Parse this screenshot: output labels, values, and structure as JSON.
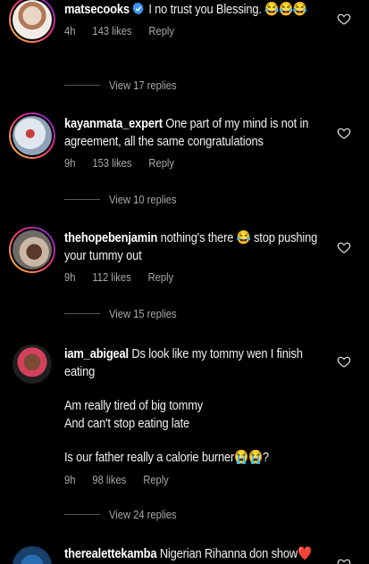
{
  "comments": [
    {
      "username": "matsecooks",
      "text": "I no trust you Blessing. 😂😂😂",
      "time": "4h",
      "likes": "143 likes",
      "reply": "Reply",
      "view_replies": "View 17 replies"
    },
    {
      "username": "kayanmata_expert",
      "text": "One part of my mind is not in agreement, all the same congratulations",
      "time": "9h",
      "likes": "153 likes",
      "reply": "Reply",
      "view_replies": "View 10 replies"
    },
    {
      "username": "thehopebenjamin",
      "text": "nothing's there 😂 stop pushing your tummy out",
      "time": "9h",
      "likes": "112 likes",
      "reply": "Reply",
      "view_replies": "View 15 replies"
    },
    {
      "username": "iam_abigeal",
      "text_line1": "Ds look like my tommy wen I finish eating",
      "text_line2": "Am really tired of big tommy",
      "text_line3": "And can't stop eating late",
      "text_line4": "Is our father really a calorie burner😭😭?",
      "time": "9h",
      "likes": "98 likes",
      "reply": "Reply",
      "view_replies": "View 24 replies"
    },
    {
      "username": "therealettekamba",
      "text": "Nigerian Rihanna don show❤️"
    }
  ],
  "colors": {
    "verified": "#3897f0",
    "ring_start": "#f9ce34",
    "ring_mid": "#ee2a7b",
    "ring_end": "#6228d7"
  },
  "icons": {
    "like": "heart-outline-icon",
    "verified": "verified-badge-icon"
  }
}
